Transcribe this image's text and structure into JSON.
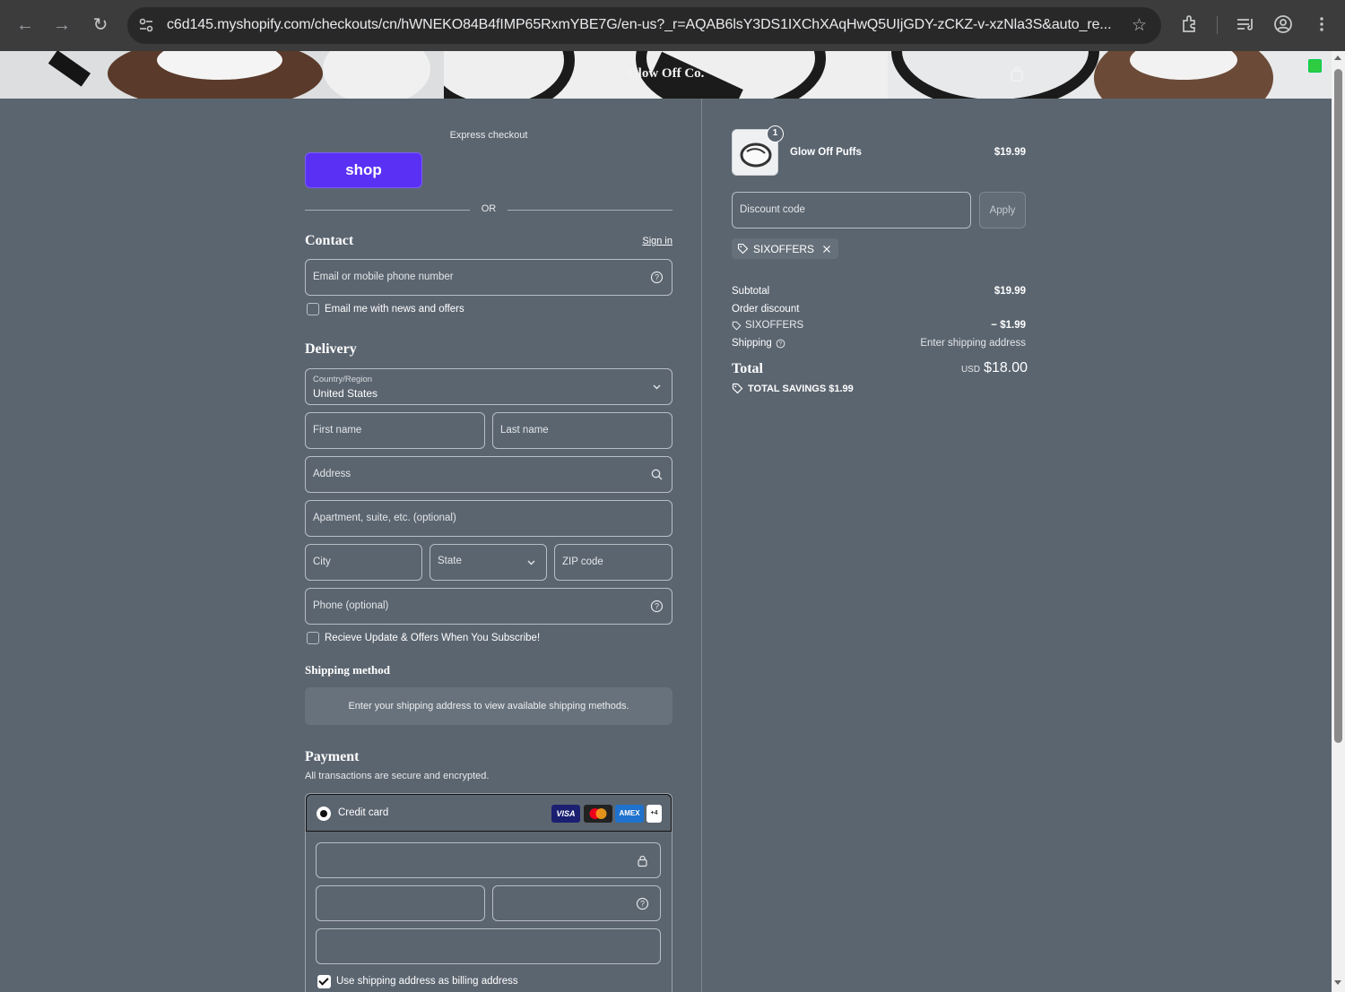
{
  "browser": {
    "url": "c6d145.myshopify.com/checkouts/cn/hWNEKO84B4fIMP65RxmYBE7G/en-us?_r=AQAB6lsY3DS1IXChXAqHwQ5UIjGDY-zCKZ-v-xzNla3S&auto_re..."
  },
  "store": {
    "brand": "Glow Off Co."
  },
  "express": {
    "label": "Express checkout",
    "shop_button": "shop",
    "or": "OR"
  },
  "contact": {
    "title": "Contact",
    "sign_in": "Sign in",
    "email_placeholder": "Email or mobile phone number",
    "news_label": "Email me with news and offers"
  },
  "delivery": {
    "title": "Delivery",
    "country_label": "Country/Region",
    "country_value": "United States",
    "first_name": "First name",
    "last_name": "Last name",
    "address": "Address",
    "apartment": "Apartment, suite, etc. (optional)",
    "city": "City",
    "state": "State",
    "zip": "ZIP code",
    "phone": "Phone (optional)",
    "subscribe_label": "Recieve Update & Offers When You Subscribe!"
  },
  "shipping_method": {
    "title": "Shipping method",
    "note": "Enter your shipping address to view available shipping methods."
  },
  "payment": {
    "title": "Payment",
    "subtitle": "All transactions are secure and encrypted.",
    "method_label": "Credit card",
    "cards": [
      "VISA",
      "Mastercard",
      "AMEX",
      "+4"
    ],
    "billing_label": "Use shipping address as billing address"
  },
  "summary": {
    "quantity": "1",
    "product_name": "Glow Off Puffs",
    "product_price": "$19.99",
    "discount_placeholder": "Discount code",
    "apply": "Apply",
    "code_tag": "SIXOFFERS",
    "subtotal_label": "Subtotal",
    "subtotal_value": "$19.99",
    "order_discount_label": "Order discount",
    "discount_code": "SIXOFFERS",
    "discount_value": "− $1.99",
    "shipping_label": "Shipping",
    "shipping_value": "Enter shipping address",
    "total_label": "Total",
    "total_currency": "USD",
    "total_value": "$18.00",
    "savings": "TOTAL SAVINGS  $1.99"
  }
}
